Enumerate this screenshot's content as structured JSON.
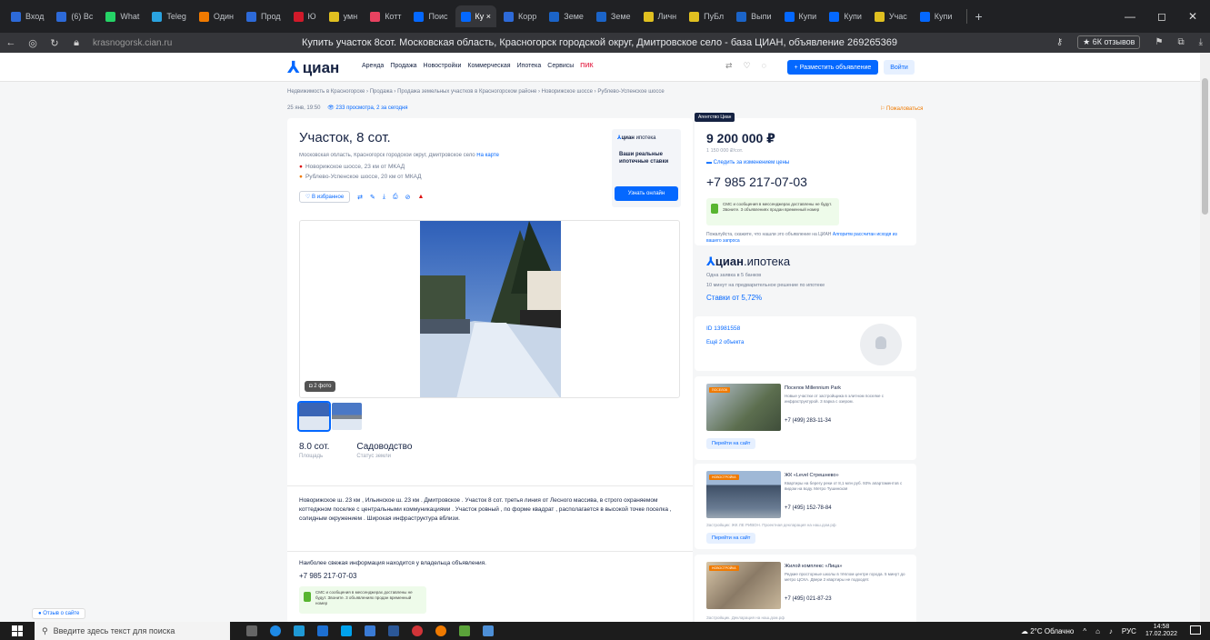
{
  "browser": {
    "tabs": [
      {
        "label": "Вход",
        "color": "#2d6ad8"
      },
      {
        "label": "(6) Вс",
        "color": "#2d6ad8"
      },
      {
        "label": "What",
        "color": "#25d366"
      },
      {
        "label": "Teleg",
        "color": "#2aa3e0"
      },
      {
        "label": "Один",
        "color": "#f07a00"
      },
      {
        "label": "Прод",
        "color": "#2d6ad8"
      },
      {
        "label": "Ю",
        "color": "#d11a2a"
      },
      {
        "label": "умн",
        "color": "#e0c020"
      },
      {
        "label": "Котт",
        "color": "#e84260"
      },
      {
        "label": "Поис",
        "color": "#0468ff"
      },
      {
        "label": "Ку ×",
        "color": "#0468ff",
        "active": true
      },
      {
        "label": "Корр",
        "color": "#2d6ad8"
      },
      {
        "label": "Земе",
        "color": "#1b64c8"
      },
      {
        "label": "Земе",
        "color": "#1b64c8"
      },
      {
        "label": "Личн",
        "color": "#e0c020"
      },
      {
        "label": "ПуБл",
        "color": "#e0c020"
      },
      {
        "label": "Выпи",
        "color": "#1b64c8"
      },
      {
        "label": "Купи",
        "color": "#0468ff"
      },
      {
        "label": "Купи",
        "color": "#0468ff"
      },
      {
        "label": "Учас",
        "color": "#e0c020"
      },
      {
        "label": "Купи",
        "color": "#0468ff"
      }
    ],
    "domain": "krasnogorsk.cian.ru",
    "page_title": "Купить участок 8сот. Московская область, Красногорск городской округ, Дмитровское село - база ЦИАН, объявление 269265369",
    "reviews_badge": "★ 6К отзывов"
  },
  "site": {
    "logo": "циан",
    "nav": [
      "Аренда",
      "Продажа",
      "Новостройки",
      "Коммерческая",
      "Ипотека",
      "Сервисы"
    ],
    "nav_pik": "ПИК",
    "post_button": "+ Разместить объявление",
    "login_button": "Войти"
  },
  "listing": {
    "breadcrumbs": "Недвижимость в Красногорске  ›  Продажа  ›  Продажа земельных участков в Красногорском районе  ›  Новорижское шоссе  ›  Рублево-Успенское шоссе",
    "date": "25 янв, 19:50",
    "views": "233 просмотра, 2 за сегодня",
    "complaint": "Пожаловаться",
    "title": "Участок, 8 сот.",
    "address": "Московская область, Красногорск городской округ, Дмитровское село",
    "map_link": "На карте",
    "highways": [
      "Новорижское шоссе, 23 км от МКАД",
      "Рублево-Успенское шоссе, 20 км от МКАД"
    ],
    "favorite": "В избранное",
    "photo_count": "2 фото",
    "facts": [
      {
        "value": "8.0 сот.",
        "label": "Площадь"
      },
      {
        "value": "Садоводство",
        "label": "Статус земли"
      }
    ],
    "description": "Новорижское ш. 23 км , Ильинское ш. 23 км . Дмитровское . Участок 8 сот. третья линия от Лесного массива, в строго охраняемом коттеджном поселке с центральными коммуникациями . Участок ровный , по форме квадрат , располагается в высокой точке поселка , солидным окружением . Широкая инфраструктура вблизи.",
    "info_line": "Наиболее свежая информация находится у владельца объявления.",
    "phone": "+7 985 217-07-03",
    "sms_note": "СМС и сообщения в мессенджерах доставлены не будут. Звоните. 3 объявлениях продан временный номер"
  },
  "mortgage_box": {
    "logo": "циан",
    "logo_suffix": "ипотека",
    "text": "Ваши реальные ипотечные ставки",
    "button": "Узнать онлайн"
  },
  "sidebar": {
    "ad_tag": "Агентство Циан",
    "price": "9 200 000 ₽",
    "price_per": "1 150 000 ₽/сот.",
    "subscribe": "Следить за изменением цены",
    "phone": "+7 985 217-07-03",
    "sms": "СМС и сообщения в мессенджерах доставлены не будут. Звоните. 3 объявлениях продан временный номер",
    "note": "Пожалуйста, скажите, что нашли это объявление на ЦИАН",
    "note_link": "Алгоритм рассчитан исходя из вашего запроса",
    "ipot_logo": "циан",
    "ipot_suffix": "ипотека",
    "ipot_l1": "Одна заявка в 5 банков",
    "ipot_l2": "10 минут на предварительное решение по ипотеке",
    "ipot_rate": "Ставки от 5,72%",
    "id": "ID 13981558",
    "objects": "Ещё 2 объекта"
  },
  "promos": [
    {
      "title": "Поселок Millennium Park",
      "text": "Новые участки от застройщика в элитном поселке с инфраструктурой. 3 парка с озером.",
      "phone": "+7 (499) 283-11-34",
      "button": "Перейти на сайт",
      "tag": "ПОСЕЛОК"
    },
    {
      "title": "ЖК «Level Стрешнево»",
      "text": "Квартиры на берегу реки от 8,1 млн руб. 93% апартаментов с видом на воду. Метро Тушинская",
      "phone": "+7 (495) 152-78-84",
      "button": "Перейти на сайт",
      "foot": "Застройщик: ЖК ЛЕ РИВОН. Проектная декларация на наш.дом.рф",
      "tag": "НОВОСТРОЙКА"
    },
    {
      "title": "Жилой комплекс «Лица»",
      "text": "Редкие просторные школы в тёплом центре города. 5 минут до метро ЦСКА. Двери 2 квартиры не подходят.",
      "phone": "+7 (495) 021-87-23",
      "foot": "Застройщик. Декларация на наш.дом.рф",
      "tag": "НОВОСТРОЙКА"
    }
  ],
  "feedback": "Отзыв о сайте",
  "taskbar": {
    "search_placeholder": "Введите здесь текст для поиска",
    "weather": "2°C Облачно",
    "lang": "РУС",
    "time": "14:58",
    "date": "17.02.2022"
  }
}
